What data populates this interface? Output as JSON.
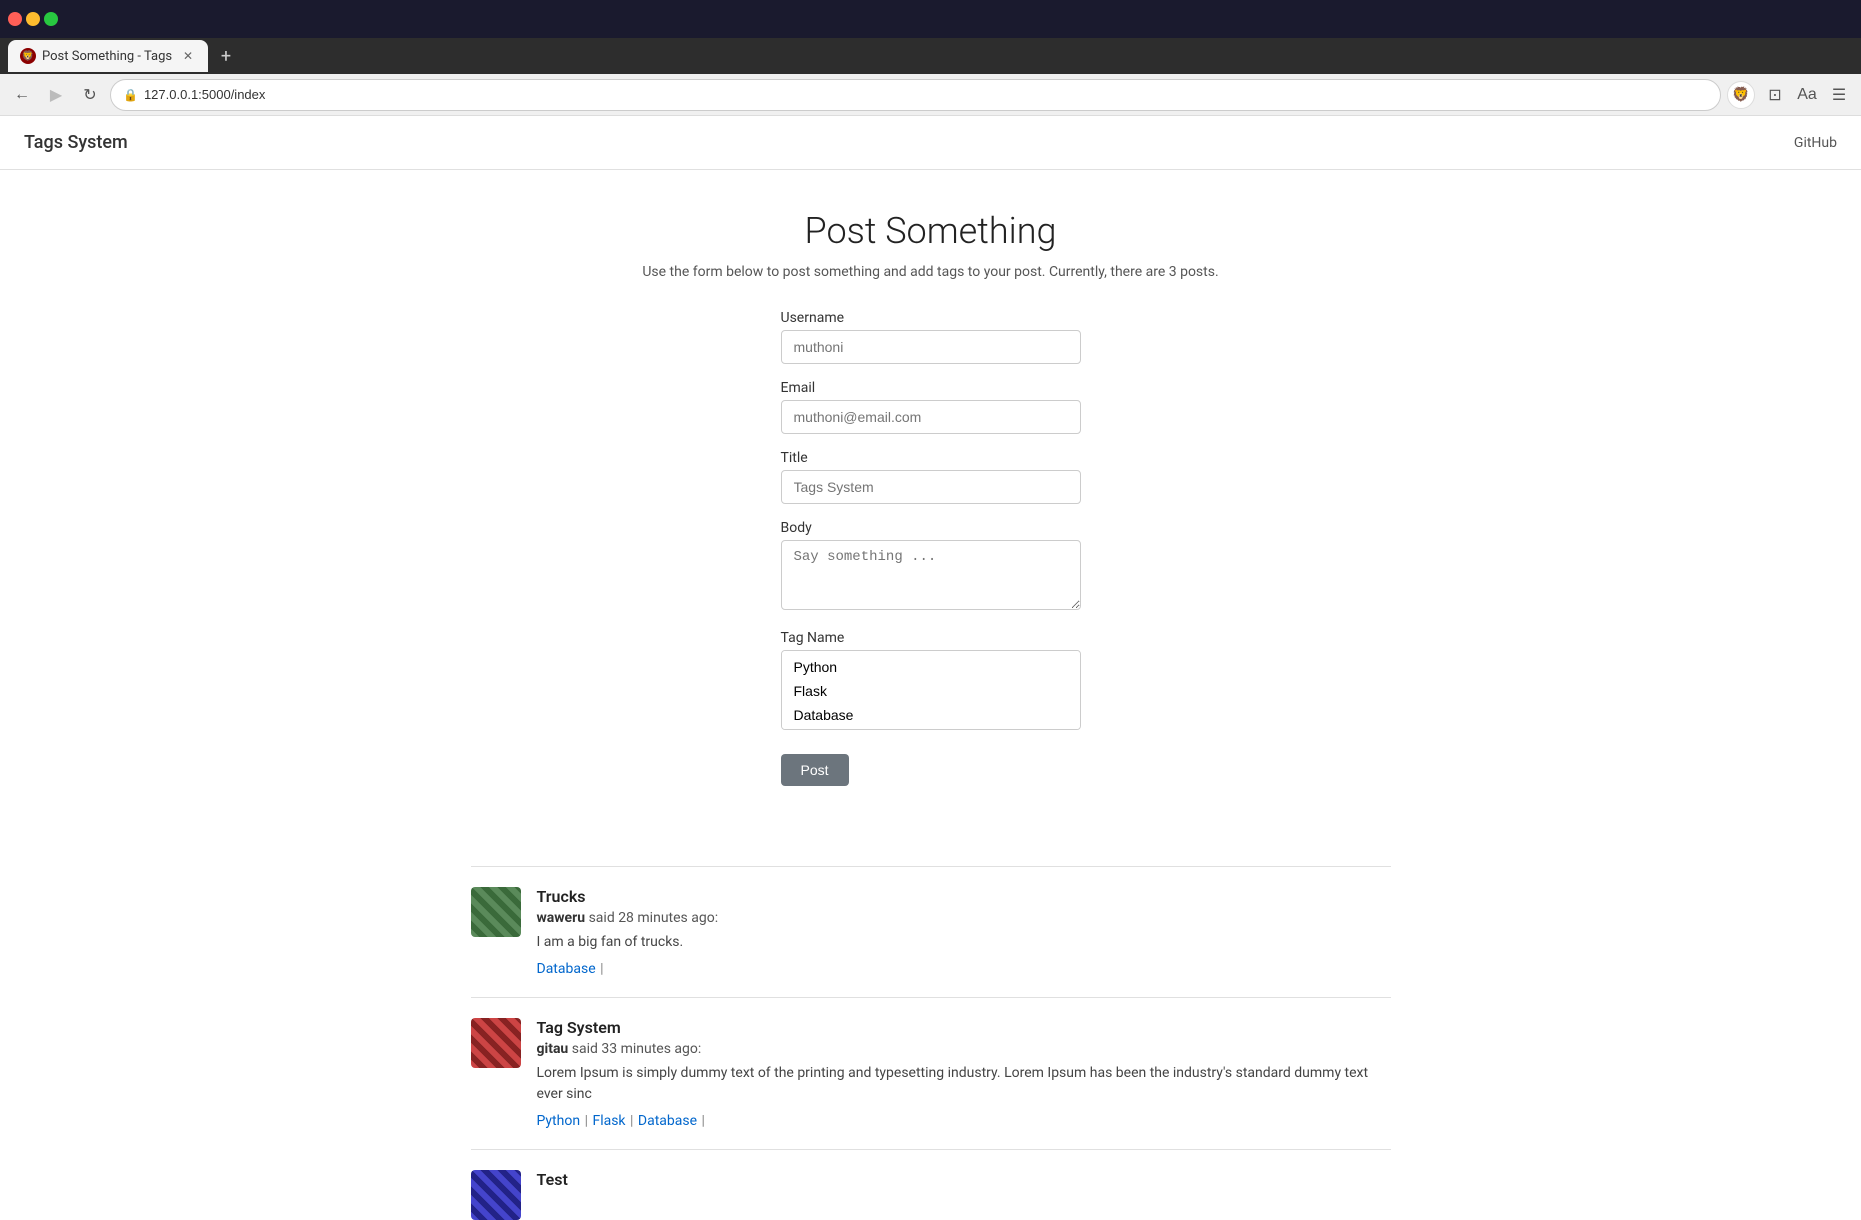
{
  "browser": {
    "tab_title": "Post Something - Tags",
    "tab_icon": "🦁",
    "url": "127.0.0.1:5000/index",
    "new_tab_label": "+",
    "nav": {
      "back_label": "←",
      "forward_label": "→",
      "reload_label": "↻"
    }
  },
  "navbar": {
    "brand": "Tags System",
    "github_label": "GitHub"
  },
  "page": {
    "heading": "Post Something",
    "subtitle": "Use the form below to post something and add tags to your post. Currently, there are 3 posts."
  },
  "form": {
    "username_label": "Username",
    "username_placeholder": "muthoni",
    "email_label": "Email",
    "email_placeholder": "muthoni@email.com",
    "title_label": "Title",
    "title_placeholder": "Tags System",
    "body_label": "Body",
    "body_placeholder": "Say something ...",
    "tag_name_label": "Tag Name",
    "tags": [
      "Python",
      "Flask",
      "Database"
    ],
    "post_button": "Post"
  },
  "posts": [
    {
      "id": 1,
      "title": "Trucks",
      "author": "waweru",
      "time_ago": "28 minutes ago",
      "body": "I am a big fan of trucks.",
      "tags": [
        {
          "name": "Database",
          "url": "#"
        }
      ],
      "avatar_style": "green"
    },
    {
      "id": 2,
      "title": "Tag System",
      "author": "gitau",
      "time_ago": "33 minutes ago",
      "body": "Lorem Ipsum is simply dummy text of the printing and typesetting industry. Lorem Ipsum has been the industry's standard dummy text ever sinc",
      "tags": [
        {
          "name": "Python",
          "url": "#"
        },
        {
          "name": "Flask",
          "url": "#"
        },
        {
          "name": "Database",
          "url": "#"
        }
      ],
      "avatar_style": "red"
    },
    {
      "id": 3,
      "title": "Test",
      "author": "",
      "time_ago": "",
      "body": "",
      "tags": [],
      "avatar_style": "blue"
    }
  ]
}
